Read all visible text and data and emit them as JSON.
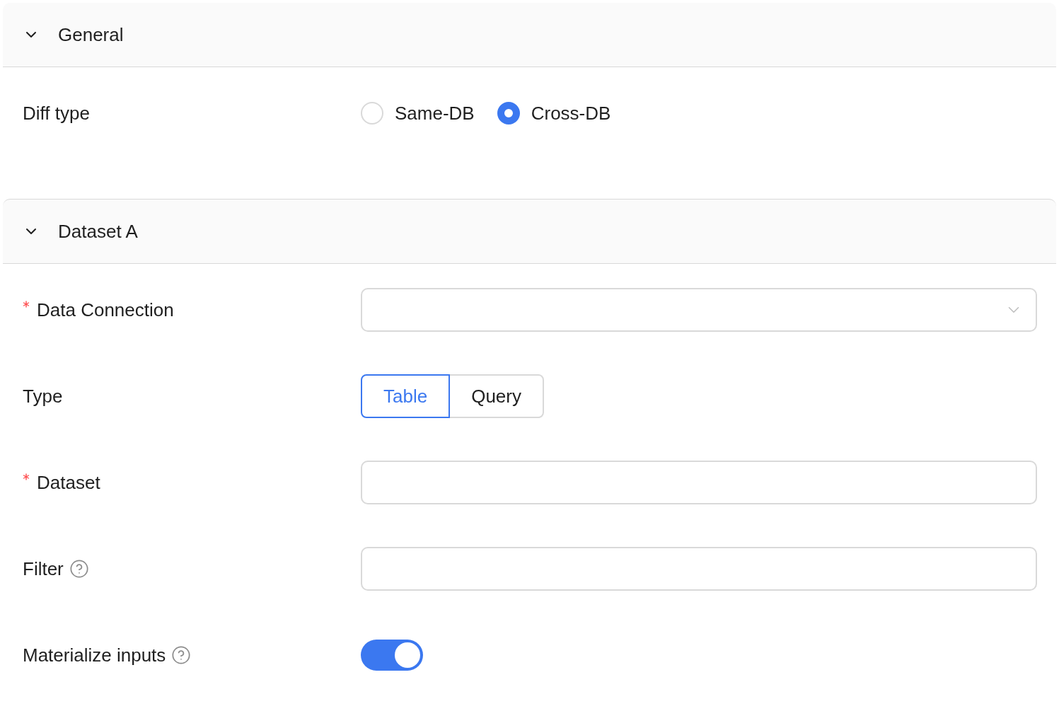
{
  "sections": [
    {
      "title": "General",
      "expanded": true,
      "fields": [
        {
          "kind": "radio",
          "label": "Diff type",
          "options": [
            {
              "label": "Same-DB",
              "selected": false
            },
            {
              "label": "Cross-DB",
              "selected": true
            }
          ]
        }
      ]
    },
    {
      "title": "Dataset A",
      "expanded": true,
      "fields": [
        {
          "kind": "select",
          "label": "Data Connection",
          "required": true
        },
        {
          "kind": "segmented",
          "label": "Type",
          "options": [
            {
              "label": "Table",
              "selected": true
            },
            {
              "label": "Query",
              "selected": false
            }
          ]
        },
        {
          "kind": "text",
          "label": "Dataset",
          "required": true
        },
        {
          "kind": "text",
          "label": "Filter",
          "help": true
        },
        {
          "kind": "switch",
          "label": "Materialize inputs",
          "help": true,
          "on": true
        }
      ]
    }
  ]
}
